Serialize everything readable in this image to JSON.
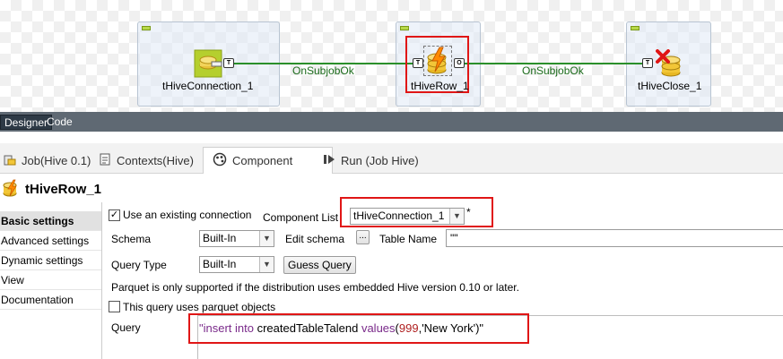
{
  "canvas": {
    "components": [
      {
        "label": "tHiveConnection_1",
        "icon": "hive-connection-icon"
      },
      {
        "label": "tHiveRow_1",
        "icon": "hive-row-icon"
      },
      {
        "label": "tHiveClose_1",
        "icon": "hive-close-icon"
      }
    ],
    "links": [
      {
        "label": "OnSubjobOk"
      },
      {
        "label": "OnSubjobOk"
      }
    ],
    "ports": {
      "trigger": "T",
      "output": "O"
    }
  },
  "mode_tabs": [
    {
      "label": "Designer",
      "selected": true
    },
    {
      "label": "Code",
      "selected": false
    }
  ],
  "main_tabs": [
    {
      "label": "Job(Hive 0.1)",
      "icon": "job-icon"
    },
    {
      "label": "Contexts(Hive)",
      "icon": "contexts-icon"
    },
    {
      "label": "Component",
      "icon": "component-icon",
      "active": true
    },
    {
      "label": "Run (Job Hive)",
      "icon": "run-icon"
    }
  ],
  "component_title": "tHiveRow_1",
  "side_nav": [
    {
      "label": "Basic settings",
      "active": true
    },
    {
      "label": "Advanced settings"
    },
    {
      "label": "Dynamic settings"
    },
    {
      "label": "View"
    },
    {
      "label": "Documentation"
    }
  ],
  "settings": {
    "use_existing_connection_label": "Use an existing connection",
    "use_existing_connection_checked": true,
    "component_list_label": "Component List",
    "component_list_value": "tHiveConnection_1",
    "component_list_marker": "*",
    "schema_label": "Schema",
    "schema_value": "Built-In",
    "edit_schema_label": "Edit schema",
    "edit_schema_button": "...",
    "table_name_label": "Table Name",
    "table_name_value": "\"\"",
    "query_type_label": "Query Type",
    "query_type_value": "Built-In",
    "guess_query_button": "Guess Query",
    "parquet_note": "Parquet is only supported if the distribution uses embedded Hive version 0.10 or later.",
    "parquet_checkbox_label": "This query uses parquet objects",
    "parquet_checked": false,
    "query_label": "Query",
    "query_text": {
      "q1": "\"insert into ",
      "table": "createdTableTalend ",
      "kw": "values",
      "open": "(",
      "num": "999",
      "rest": ",'New York')\""
    }
  },
  "colors": {
    "highlight_red": "#e01616",
    "link_green": "#2a8f2a",
    "keyword_purple": "#7a2a8a",
    "number_red": "#b02020",
    "mode_bar": "#5f6973"
  }
}
